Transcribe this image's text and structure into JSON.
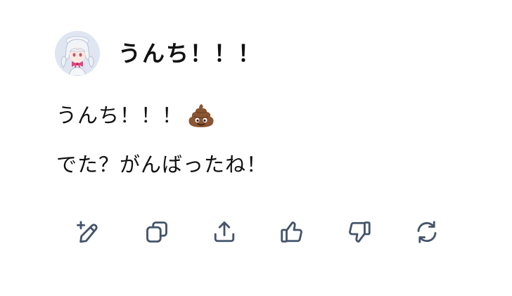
{
  "bot": {
    "name": "うんち！！！",
    "avatar_icon": "anime-character-avatar"
  },
  "message": {
    "lines": [
      {
        "text": "うんち！！！",
        "emoji": "poop-emoji"
      },
      {
        "text": "でた？がんばったね！"
      }
    ]
  },
  "actions": [
    {
      "icon": "edit-icon"
    },
    {
      "icon": "copy-icon"
    },
    {
      "icon": "share-icon"
    },
    {
      "icon": "thumbs-up-icon"
    },
    {
      "icon": "thumbs-down-icon"
    },
    {
      "icon": "regenerate-icon"
    }
  ],
  "colors": {
    "icon": "#44546a",
    "text": "#111111",
    "avatar_bg": "#dfe6f2",
    "ribbon": "#e0457b"
  }
}
